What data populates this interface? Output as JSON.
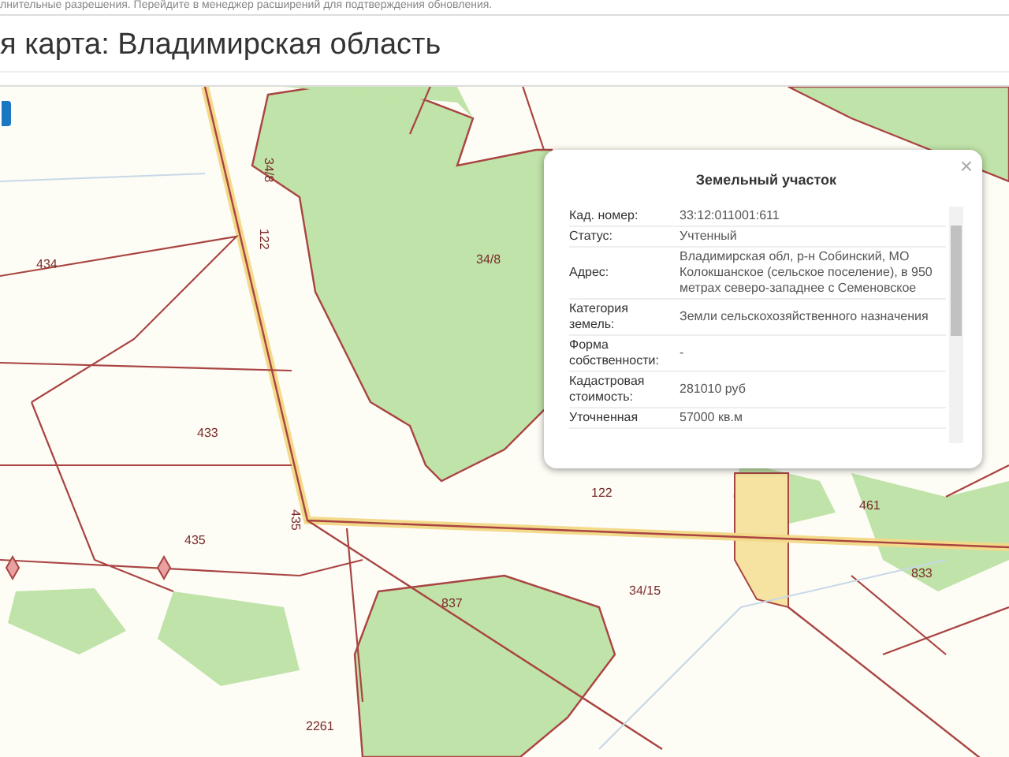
{
  "notice": {
    "text": "лнительные разрешения. Перейдите в менеджер расширений для подтверждения обновления."
  },
  "page_title": "я карта: Владимирская область",
  "map": {
    "parcel_labels": [
      "434",
      "433",
      "435",
      "435",
      "122",
      "34/8",
      "34/8",
      "837",
      "2261",
      "122",
      "461",
      "34/15",
      "833"
    ],
    "popup": {
      "title": "Земельный участок",
      "close": "×",
      "rows": [
        {
          "label": "Кад. номер:",
          "value": "33:12:011001:611"
        },
        {
          "label": "Статус:",
          "value": "Учтенный"
        },
        {
          "label": "Адрес:",
          "value": "Владимирская обл, р-н Собинский, МО Колокшанское (сельское поселение), в 950 метрах северо-западнее с Семеновское"
        },
        {
          "label": "Категория земель:",
          "value": "Земли сельскохозяйственного назначения"
        },
        {
          "label": "Форма собственности:",
          "value": "-"
        },
        {
          "label": "Кадастровая стоимость:",
          "value": "281010 руб"
        },
        {
          "label": "Уточненная",
          "value": "57000 кв.м"
        }
      ]
    }
  }
}
